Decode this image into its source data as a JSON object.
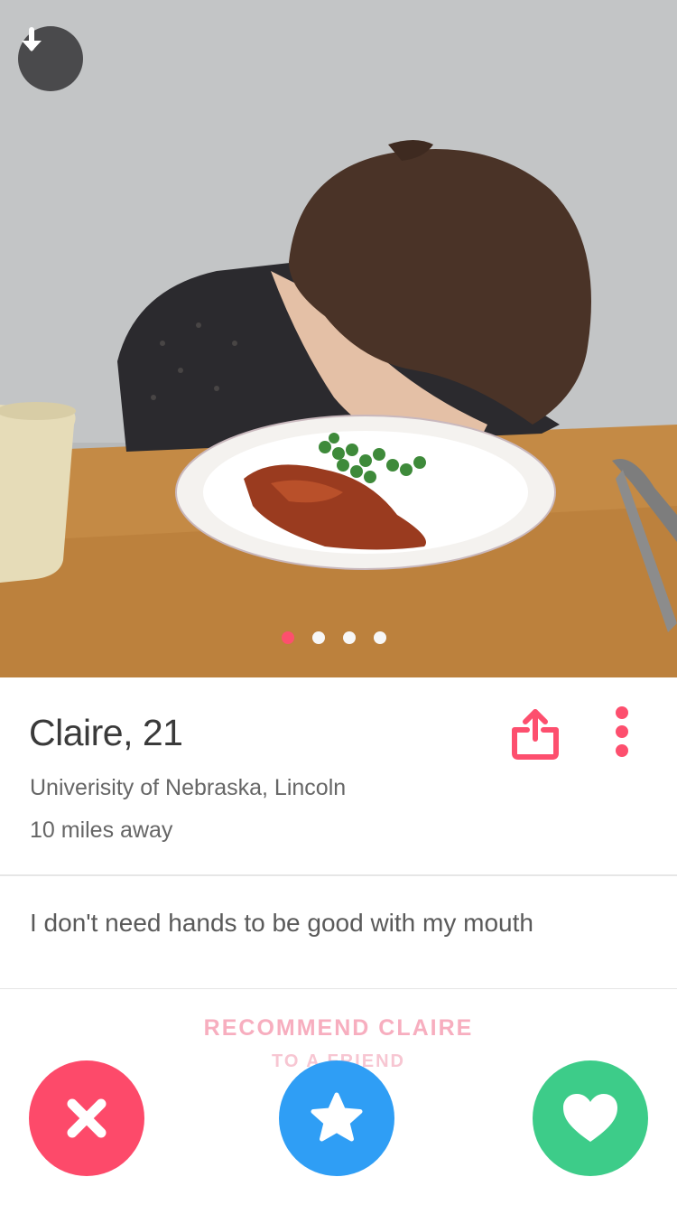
{
  "photo": {
    "download_icon": "arrow-down-icon",
    "pager": {
      "total": 4,
      "active_index": 0
    }
  },
  "profile": {
    "name_age": "Claire, 21",
    "school": "Univerisity of Nebraska, Lincoln",
    "distance": "10 miles away",
    "share_icon": "share-icon",
    "more_icon": "more-vertical-icon"
  },
  "bio": {
    "text": "I don't need hands to be good with my mouth"
  },
  "recommend": {
    "label": "RECOMMEND CLAIRE",
    "sub_label": "TO A FRIEND"
  },
  "actions": {
    "nope_icon": "close-icon",
    "superlike_icon": "star-icon",
    "like_icon": "heart-icon"
  },
  "colors": {
    "accent": "#fd4f6e",
    "nope": "#fd4a6a",
    "superlike": "#2f9ef5",
    "like": "#3dcc89"
  }
}
